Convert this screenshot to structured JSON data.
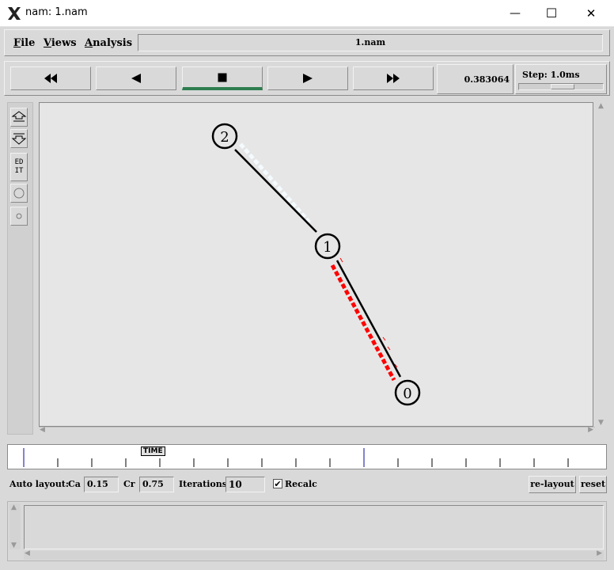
{
  "window": {
    "title": "nam: 1.nam",
    "minimize": "—",
    "maximize": "☐",
    "close": "✕"
  },
  "menubar": {
    "file": {
      "first": "F",
      "rest": "ile"
    },
    "views": {
      "first": "V",
      "rest": "iews"
    },
    "analysis": {
      "first": "A",
      "rest": "nalysis"
    },
    "filename": "1.nam"
  },
  "playback": {
    "buttons": [
      "rewind-icon",
      "back-icon",
      "stop-icon",
      "play-icon",
      "fast-forward-icon"
    ],
    "time": "0.383064",
    "step_label": "Step: 1.0ms"
  },
  "tools": {
    "edit_label_1": "ED",
    "edit_label_2": "IT"
  },
  "nodes": [
    {
      "label": "2"
    },
    {
      "label": "1"
    },
    {
      "label": "0"
    }
  ],
  "colors": {
    "link": "#000000",
    "packet_red": "#ff0000",
    "packet_white": "#f4fbff",
    "active_play": "#2e7d4f"
  },
  "timeline": {
    "marker_label": "TIME"
  },
  "autolayout": {
    "label": "Auto layout:",
    "ca_label": "Ca",
    "ca_value": "0.15",
    "cr_label": "Cr",
    "cr_value": "0.75",
    "iterations_label": "Iterations",
    "iterations_value": "10",
    "recalc_label": "Recalc",
    "recalc_checked": true,
    "relayout_label": "re-layout",
    "reset_label": "reset"
  }
}
